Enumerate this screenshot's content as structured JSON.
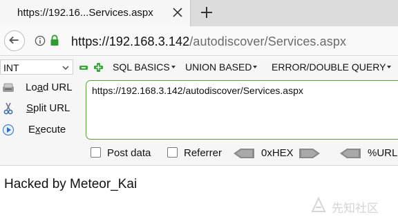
{
  "tab": {
    "title": "https://192.16...Services.aspx"
  },
  "navbar": {
    "url_host": "https://192.168.3.142",
    "url_path": "/autodiscover/Services.aspx"
  },
  "hackbar": {
    "type_value": "INT",
    "menus": [
      "SQL BASICS",
      "UNION BASED",
      "ERROR/DOUBLE QUERY"
    ],
    "buttons": {
      "load_url": {
        "pre": "Lo",
        "key": "a",
        "post": "d URL"
      },
      "split_url": {
        "pre": "",
        "key": "S",
        "post": "plit URL"
      },
      "execute": {
        "pre": "E",
        "key": "x",
        "post": "ecute"
      }
    },
    "url_text": "https://192.168.3.142/autodiscover/Services.aspx",
    "options": {
      "post_data": "Post data",
      "referrer": "Referrer",
      "hex": "0xHEX",
      "url_encode": "%URL"
    }
  },
  "page": {
    "content": "Hacked by Meteor_Kai"
  },
  "watermark": {
    "text": "先知社区"
  },
  "colors": {
    "accent_green": "#3aa63a",
    "url_border": "#5a9e3c",
    "lock_green": "#2e9b2e"
  }
}
